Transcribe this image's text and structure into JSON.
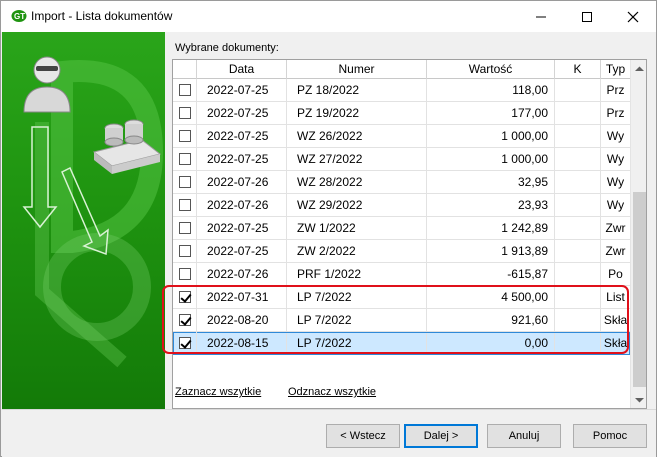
{
  "window": {
    "title": "Import - Lista dokumentów"
  },
  "list": {
    "label": "Wybrane dokumenty:",
    "columns": [
      "Data",
      "Numer",
      "Wartość",
      "K",
      "Typ"
    ],
    "rows": [
      {
        "checked": false,
        "date": "2022-07-25",
        "number": "PZ 18/2022",
        "value": "118,00",
        "k": "",
        "type": "Prz"
      },
      {
        "checked": false,
        "date": "2022-07-25",
        "number": "PZ 19/2022",
        "value": "177,00",
        "k": "",
        "type": "Prz"
      },
      {
        "checked": false,
        "date": "2022-07-25",
        "number": "WZ 26/2022",
        "value": "1 000,00",
        "k": "",
        "type": "Wy"
      },
      {
        "checked": false,
        "date": "2022-07-25",
        "number": "WZ 27/2022",
        "value": "1 000,00",
        "k": "",
        "type": "Wy"
      },
      {
        "checked": false,
        "date": "2022-07-26",
        "number": "WZ 28/2022",
        "value": "32,95",
        "k": "",
        "type": "Wy"
      },
      {
        "checked": false,
        "date": "2022-07-26",
        "number": "WZ 29/2022",
        "value": "23,93",
        "k": "",
        "type": "Wy"
      },
      {
        "checked": false,
        "date": "2022-07-25",
        "number": "ZW 1/2022",
        "value": "1 242,89",
        "k": "",
        "type": "Zwr"
      },
      {
        "checked": false,
        "date": "2022-07-25",
        "number": "ZW 2/2022",
        "value": "1 913,89",
        "k": "",
        "type": "Zwr"
      },
      {
        "checked": false,
        "date": "2022-07-26",
        "number": "PRF 1/2022",
        "value": "-615,87",
        "k": "",
        "type": "Po"
      },
      {
        "checked": true,
        "date": "2022-07-31",
        "number": "LP 7/2022",
        "value": "4 500,00",
        "k": "",
        "type": "List"
      },
      {
        "checked": true,
        "date": "2022-08-20",
        "number": "LP 7/2022",
        "value": "921,60",
        "k": "",
        "type": "Skła"
      },
      {
        "checked": true,
        "date": "2022-08-15",
        "number": "LP 7/2022",
        "value": "0,00",
        "k": "",
        "type": "Skła",
        "selected": true
      }
    ]
  },
  "links": {
    "select_all": "Zaznacz wszytkie",
    "deselect_all": "Odznacz wszytkie"
  },
  "buttons": {
    "back": "< Wstecz",
    "next": "Dalej >",
    "cancel": "Anuluj",
    "help": "Pomoc"
  },
  "colors": {
    "side_panel_green": "#1f9410",
    "highlight_red": "#e0101a",
    "selection_blue": "#cde8ff"
  }
}
